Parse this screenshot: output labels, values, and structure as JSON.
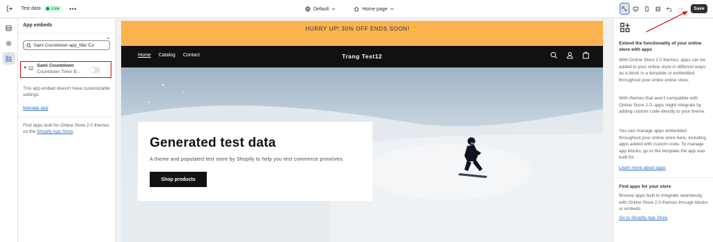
{
  "topbar": {
    "theme_name": "Test data",
    "live_badge": "Live",
    "more": "•••",
    "theme_select": "Default",
    "page_select": "Home page",
    "save_label": "Save"
  },
  "left_panel": {
    "title": "App embeds",
    "search_value": "Sami Countdown app_title:'Co",
    "embed": {
      "title": "Sami Countdown",
      "subtitle": "Countdown Timer B...",
      "enabled": false
    },
    "no_settings_text": "This app embed doesn't have customizable settings.",
    "manage_link": "Manage app",
    "find_text_prefix": "Find apps built for Online Store 2.0 themes on the ",
    "find_link": "Shopify App Store",
    "find_text_suffix": "."
  },
  "preview": {
    "announcement": "HURRY UP! 30% OFF ENDS SOON! ✋",
    "nav": [
      "Home",
      "Catalog",
      "Contact"
    ],
    "brand": "Trang Test12",
    "hero_title": "Generated test data",
    "hero_subtitle": "A theme and populated test store by Shopify to help you test commerce primitives.",
    "hero_button": "Shop products"
  },
  "right_panel": {
    "heading1": "Extend the functionality of your online store with apps",
    "para1": "With Online Store 2.0 themes, apps can be added to your online store in different ways: as a block in a template or embedded throughout your entire online store.",
    "para2": "With themes that aren't compatible with Online Store 2.0, apps might integrate by adding custom code directly to your theme.",
    "para3": "You can manage apps embedded throughout your online store here, including apps added with custom code. To manage app blocks, go to the template the app was built for.",
    "link1": "Learn more about apps",
    "heading2": "Find apps for your store",
    "para4": "Browse apps built to integrate seamlessly with Online Store 2.0 themes through blocks or embeds.",
    "link2": "Go to Shopify App Store"
  },
  "colors": {
    "announcement_bg": "#fbb34f",
    "header_bg": "#111111",
    "highlight": "#e00000",
    "link": "#2c6ecb",
    "live_badge": "#cdfee1"
  },
  "icons": [
    "exit-icon",
    "sections-icon",
    "settings-icon",
    "app-embeds-icon",
    "search-icon",
    "drag-grid-icon",
    "globe-icon",
    "home-icon",
    "chevron-down-icon",
    "inspect-icon",
    "desktop-icon",
    "mobile-icon",
    "fullscreen-icon",
    "undo-icon",
    "redo-icon",
    "apps-add-icon",
    "search-store-icon",
    "account-icon",
    "cart-icon"
  ]
}
